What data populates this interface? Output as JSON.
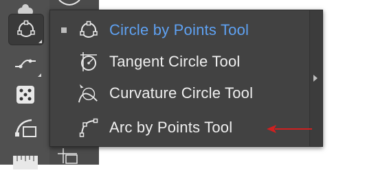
{
  "flyout": {
    "items": [
      {
        "label": "Circle by Points Tool",
        "icon": "circle-by-points-icon",
        "selected": true
      },
      {
        "label": "Tangent Circle Tool",
        "icon": "tangent-circle-icon",
        "selected": false
      },
      {
        "label": "Curvature Circle Tool",
        "icon": "curvature-circle-icon",
        "selected": false
      },
      {
        "label": "Arc by Points Tool",
        "icon": "arc-by-points-icon",
        "selected": false
      }
    ]
  },
  "toolbar": {
    "tools": [
      "puppet-icon",
      "circle-by-points-icon",
      "curve-icon",
      "dice-icon",
      "arc-icon",
      "ruler-icon"
    ]
  },
  "colors": {
    "selected_text": "#5fa2f3",
    "menu_bg": "#424242",
    "toolbar_bg": "#505050",
    "annotation_arrow": "#d02020"
  }
}
